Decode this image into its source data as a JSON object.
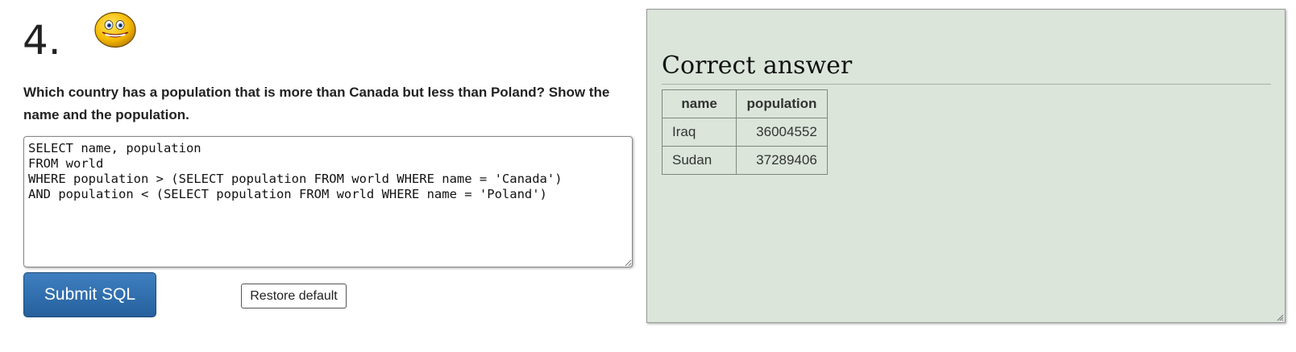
{
  "question": {
    "number": "4.",
    "text": "Which country has a population that is more than Canada but less than Poland? Show the name and the population.",
    "status_icon": "smiley-face-icon"
  },
  "editor": {
    "value": "SELECT name, population\nFROM world\nWHERE population > (SELECT population FROM world WHERE name = 'Canada')\nAND population < (SELECT population FROM world WHERE name = 'Poland')"
  },
  "buttons": {
    "submit_label": "Submit SQL",
    "restore_label": "Restore default"
  },
  "answer": {
    "title": "Correct answer",
    "columns": [
      "name",
      "population"
    ],
    "rows": [
      [
        "Iraq",
        "36004552"
      ],
      [
        "Sudan",
        "37289406"
      ]
    ]
  },
  "colors": {
    "panel_background": "#dbe5da",
    "submit_button": "#2f6eae"
  }
}
